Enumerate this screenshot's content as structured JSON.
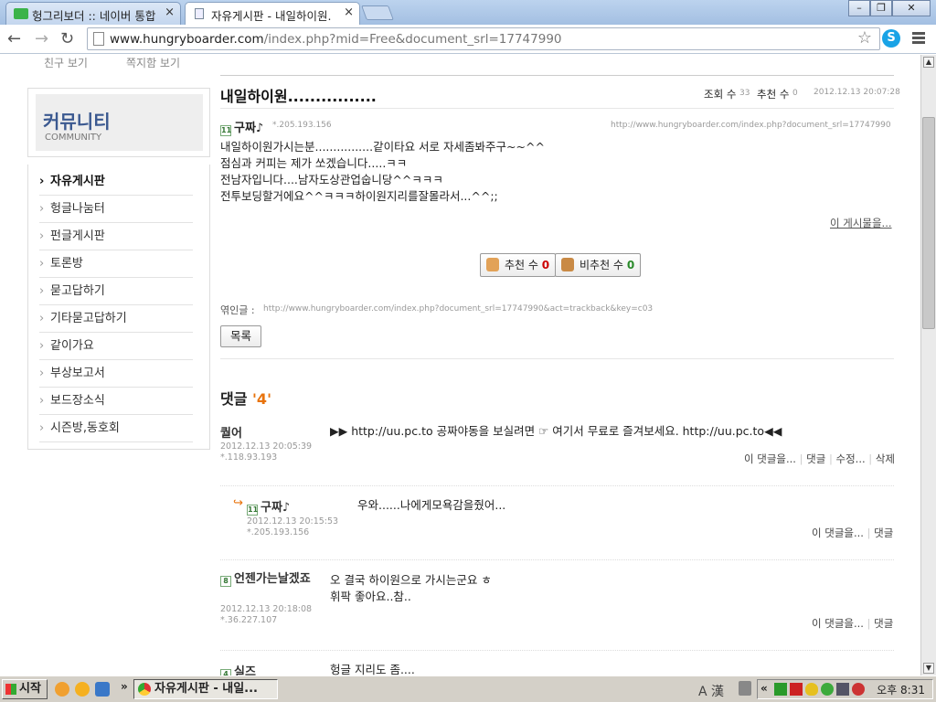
{
  "browser": {
    "tabs": [
      {
        "label": "헝그리보더 :: 네이버 통합",
        "close": "×"
      },
      {
        "label": "자유게시판 - 내일하이원.",
        "close": "×"
      }
    ],
    "window_controls": {
      "minimize": "–",
      "restore": "❐",
      "close": "✕"
    },
    "url_host": "www.hungryboarder.com",
    "url_path": "/index.php?mid=Free&document_srl=17747990",
    "nav": {
      "back": "←",
      "forward": "→",
      "reload": "↻",
      "star": "☆",
      "skype": "S"
    }
  },
  "sidebar": {
    "top_links": [
      "친구 보기",
      "쪽지함 보기"
    ],
    "community_title": "커뮤니티",
    "community_sub": "COMMUNITY",
    "menu": [
      "자유게시판",
      "헝글나눔터",
      "펀글게시판",
      "토론방",
      "묻고답하기",
      "기타묻고답하기",
      "같이가요",
      "부상보고서",
      "보드장소식",
      "시즌방,동호회"
    ],
    "active_index": 0
  },
  "post": {
    "title": "내일하이원................",
    "views_label": "조회 수",
    "views": "33",
    "votes_label": "추천 수",
    "votes": "0",
    "date": "2012.12.13 20:07:28",
    "level": "11",
    "author": "구짜♪",
    "author_ip": "*.205.193.156",
    "doc_url": "http://www.hungryboarder.com/index.php?document_srl=17747990",
    "body": [
      "내일하이원가시는분................같이타요 서로 자세좀봐주구~~^^",
      "점심과 커피는 제가 쏘겠습니다.....ㅋㅋ",
      "전남자입니다....남자도상관업숩니당^^ㅋㅋㅋ",
      "전투보딩할거에요^^ㅋㅋㅋ하이원지리를잘몰라서...^^;;"
    ],
    "more_link": "이 게시물을...",
    "recommend_label": "추천 수",
    "recommend_count": "0",
    "unrecommend_label": "비추천 수",
    "unrecommend_count": "0",
    "trackback_label": "엮인글 :",
    "trackback_url": "http://www.hungryboarder.com/index.php?document_srl=17747990&act=trackback&key=c03",
    "list_button": "목록"
  },
  "comments_header": {
    "label": "댓글",
    "count": "'4'"
  },
  "comments": [
    {
      "author": "퀄어",
      "date": "2012.12.13 20:05:39",
      "ip": "*.118.93.193",
      "body": [
        "▶▶ http://uu.pc.to 공짜야동을 보실려면 ☞ 여기서 무료로 즐겨보세요. http://uu.pc.to◀◀"
      ],
      "actions": [
        "이 댓글을...",
        "댓글",
        "수정...",
        "삭제"
      ]
    },
    {
      "level": "11",
      "author": "구짜♪",
      "date": "2012.12.13 20:15:53",
      "ip": "*.205.193.156",
      "body": [
        "우와......나에게모욕감을줬어..."
      ],
      "actions": [
        "이 댓글을...",
        "댓글"
      ]
    },
    {
      "level": "8",
      "author": "언젠가는날겠죠",
      "date": "2012.12.13 20:18:08",
      "ip": "*.36.227.107",
      "body": [
        "오 결국 하이원으로 가시는군요 ㅎ",
        "휘팍 좋아요..참.."
      ],
      "actions": [
        "이 댓글을...",
        "댓글"
      ]
    },
    {
      "level": "4",
      "author": "실즈",
      "body": [
        "헝글 지리도 좀...."
      ]
    }
  ],
  "taskbar": {
    "start": "시작",
    "chevron": "»",
    "task_label": "자유게시판 - 내일...",
    "tray_text": "A 漢",
    "tray_chevron": "«",
    "clock": "오후 8:31"
  },
  "colors": {
    "accent_orange": "#e8730c",
    "link_blue": "#3b5990",
    "red_count": "#cc0000",
    "green_count": "#2a8a2a"
  }
}
